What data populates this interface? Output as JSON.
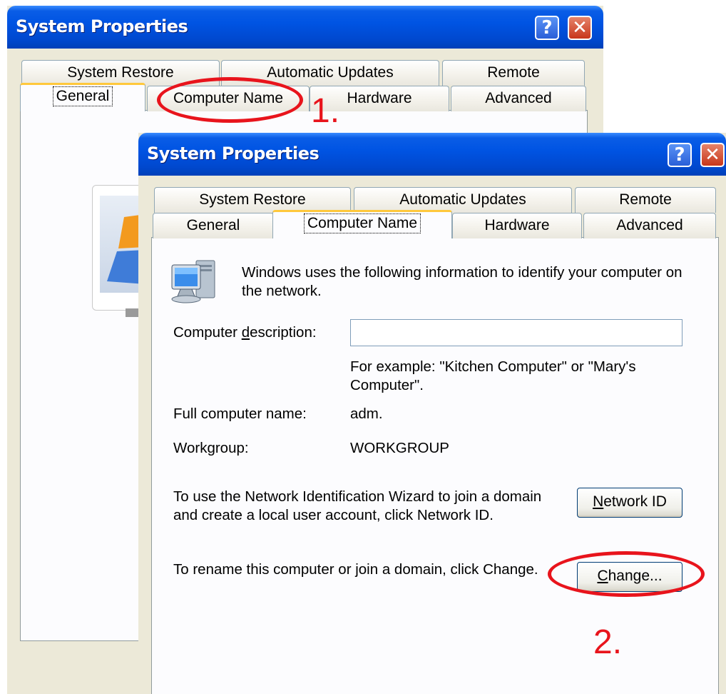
{
  "back_window": {
    "title": "System Properties",
    "help_glyph": "?",
    "close_glyph": "✕",
    "tabs_row1": [
      "System Restore",
      "Automatic Updates",
      "Remote"
    ],
    "tabs_row2": [
      "General",
      "Computer Name",
      "Hardware",
      "Advanced"
    ],
    "active_tab": "General"
  },
  "front_window": {
    "title": "System Properties",
    "help_glyph": "?",
    "close_glyph": "✕",
    "tabs_row1": [
      "System Restore",
      "Automatic Updates",
      "Remote"
    ],
    "tabs_row2": [
      "General",
      "Computer Name",
      "Hardware",
      "Advanced"
    ],
    "active_tab": "Computer Name",
    "intro": "Windows uses the following information to identify your computer on the network.",
    "description_label_pre": "Computer ",
    "description_label_accel": "d",
    "description_label_post": "escription:",
    "description_value": "",
    "example_text": "For example: \"Kitchen Computer\" or \"Mary's Computer\".",
    "full_name_label": "Full computer name:",
    "full_name_value": "adm.",
    "workgroup_label": "Workgroup:",
    "workgroup_value": "WORKGROUP",
    "network_id_text": "To use the Network Identification Wizard to join a domain and create a local user account, click Network ID.",
    "network_id_button_accel": "N",
    "network_id_button_rest": "etwork ID",
    "rename_text": "To rename this computer or join a domain, click Change.",
    "change_button_accel": "C",
    "change_button_rest": "hange..."
  },
  "annotations": [
    "1.",
    "2."
  ],
  "colors": {
    "titlebar_blue": "#0054E3",
    "dialog_bg": "#ECE9D8",
    "annotation_red": "#E8141C",
    "active_tab_orange": "#FFC83C"
  }
}
